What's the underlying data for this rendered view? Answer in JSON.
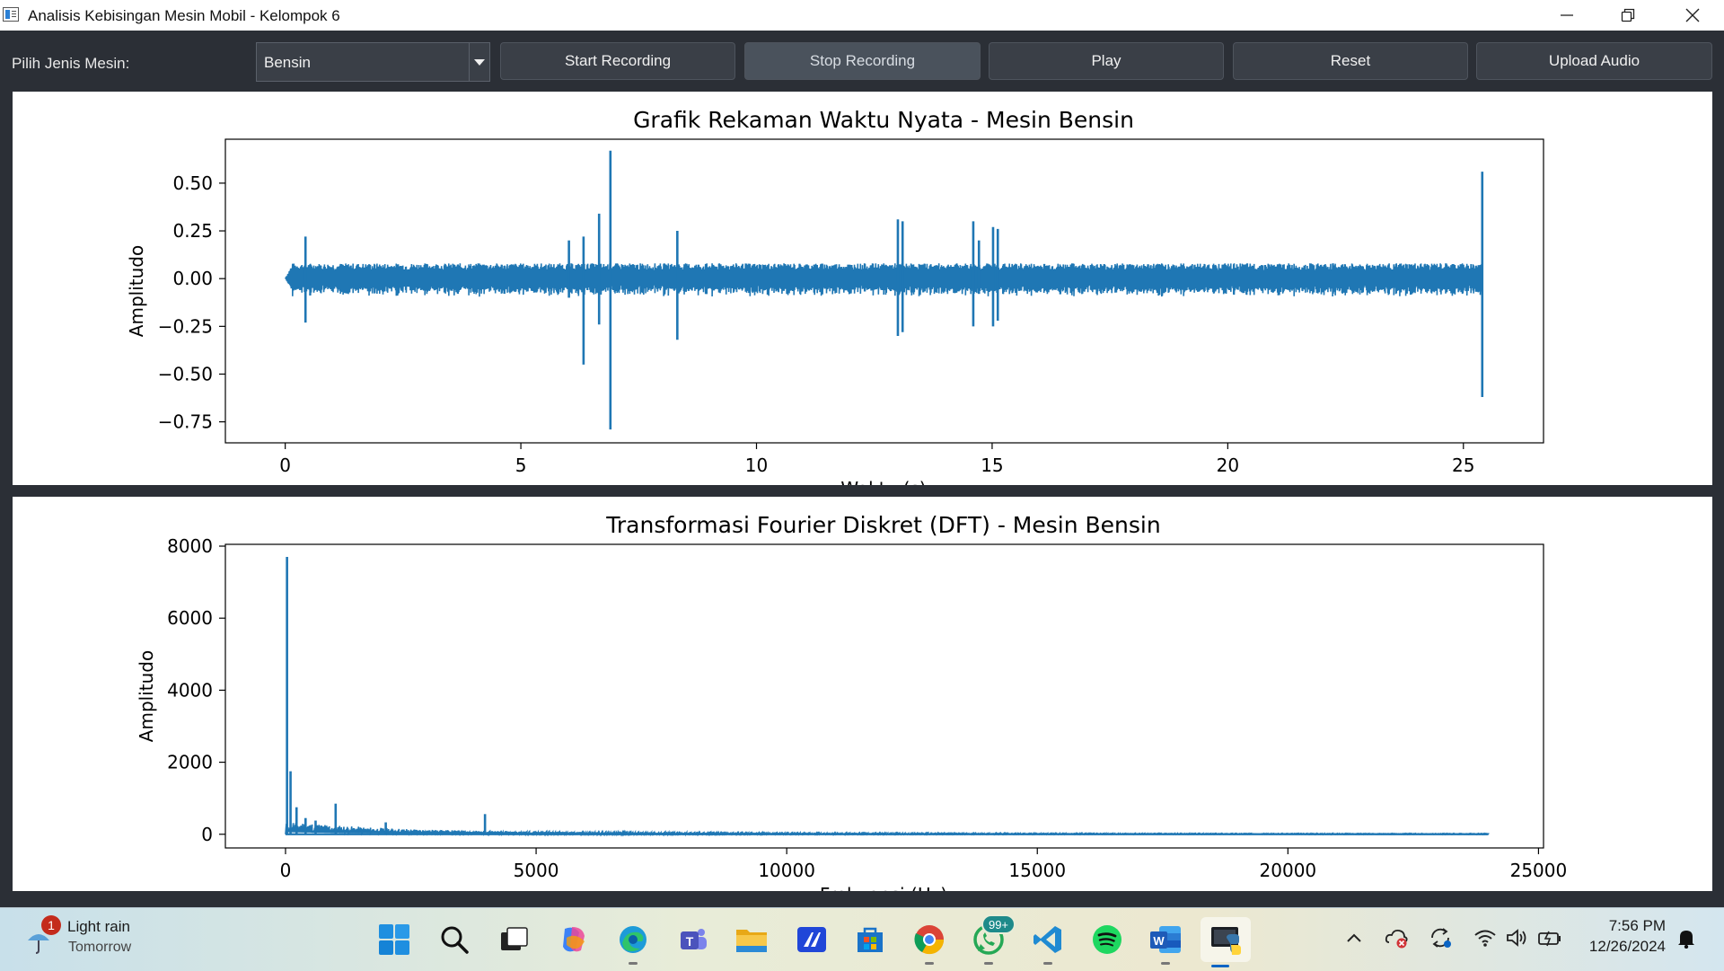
{
  "window": {
    "title": "Analisis Kebisingan Mesin Mobil - Kelompok 6",
    "minimize_icon": "minimize-icon",
    "maximize_icon": "restore-icon",
    "close_icon": "close-icon"
  },
  "toolbar": {
    "machine_label": "Pilih Jenis Mesin:",
    "machine_selected": "Bensin",
    "buttons": [
      {
        "label": "Start Recording",
        "active": false
      },
      {
        "label": "Stop Recording",
        "active": true
      },
      {
        "label": "Play",
        "active": false
      },
      {
        "label": "Reset",
        "active": false
      },
      {
        "label": "Upload Audio",
        "active": false
      }
    ]
  },
  "chart_data": [
    {
      "type": "line",
      "title": "Grafik Rekaman Waktu Nyata - Mesin Bensin",
      "xlabel": "Waktu (s)",
      "ylabel": "Amplitudo",
      "xlim": [
        -1.27,
        26.7
      ],
      "ylim": [
        -0.86,
        0.73
      ],
      "xticks": [
        0,
        5,
        10,
        15,
        20,
        25
      ],
      "yticks": [
        0.5,
        0.25,
        0.0,
        -0.25,
        -0.5,
        -0.75
      ],
      "ytick_labels": [
        "0.50",
        "0.25",
        "0.00",
        "−0.25",
        "−0.50",
        "−0.75"
      ],
      "color": "#1f77b4",
      "duration": 25.4,
      "noise_band": [
        -0.08,
        0.08
      ],
      "spikes": [
        {
          "x": 0.43,
          "y": 0.22,
          "neg": -0.23
        },
        {
          "x": 6.02,
          "y": 0.2,
          "neg": -0.1
        },
        {
          "x": 6.33,
          "y": 0.22,
          "neg": -0.45
        },
        {
          "x": 6.66,
          "y": 0.34,
          "neg": -0.24
        },
        {
          "x": 6.9,
          "y": 0.67,
          "neg": -0.79
        },
        {
          "x": 8.32,
          "y": 0.25,
          "neg": -0.32
        },
        {
          "x": 13.0,
          "y": 0.31,
          "neg": -0.3
        },
        {
          "x": 13.1,
          "y": 0.3,
          "neg": -0.28
        },
        {
          "x": 14.6,
          "y": 0.3,
          "neg": -0.25
        },
        {
          "x": 14.72,
          "y": 0.2,
          "neg": -0.08
        },
        {
          "x": 15.02,
          "y": 0.27,
          "neg": -0.25
        },
        {
          "x": 15.12,
          "y": 0.26,
          "neg": -0.22
        },
        {
          "x": 25.4,
          "y": 0.56,
          "neg": -0.62
        }
      ]
    },
    {
      "type": "line",
      "title": "Transformasi Fourier Diskret (DFT) - Mesin Bensin",
      "xlabel": "Frekuensi (Hz)",
      "ylabel": "Amplitudo",
      "xlim": [
        -1200,
        25100
      ],
      "ylim": [
        -380,
        8050
      ],
      "xticks": [
        0,
        5000,
        10000,
        15000,
        20000,
        25000
      ],
      "yticks": [
        0,
        2000,
        4000,
        6000,
        8000
      ],
      "color": "#1f77b4",
      "max_freq": 24000,
      "peaks": [
        {
          "x": 30,
          "y": 7700
        },
        {
          "x": 100,
          "y": 1750
        },
        {
          "x": 220,
          "y": 750
        },
        {
          "x": 400,
          "y": 450
        },
        {
          "x": 600,
          "y": 380
        },
        {
          "x": 1000,
          "y": 850
        },
        {
          "x": 2000,
          "y": 330
        },
        {
          "x": 3980,
          "y": 560
        }
      ]
    }
  ],
  "taskbar": {
    "weather_badge": "1",
    "weather_main": "Light rain",
    "weather_sub": "Tomorrow",
    "whatsapp_badge": "99+",
    "clock_time": "7:56 PM",
    "clock_date": "12/26/2024"
  }
}
